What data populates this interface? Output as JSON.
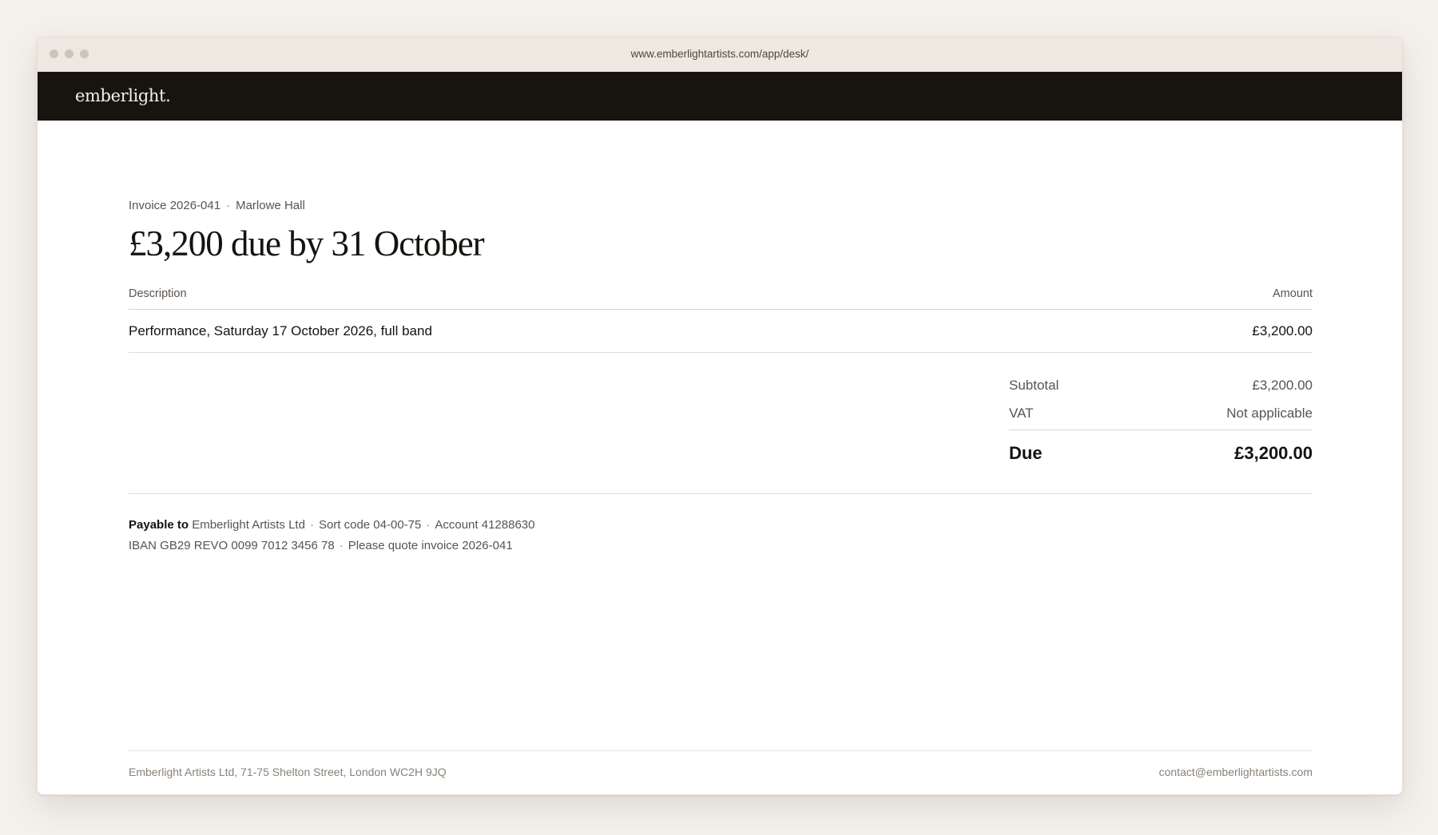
{
  "browser": {
    "url": "www.emberlightartists.com/app/desk/"
  },
  "brand": {
    "logo_text": "emberlight."
  },
  "invoice": {
    "number": "Invoice 2026-041",
    "separator": "·",
    "client": "Marlowe Hall",
    "title": "£3,200 due by 31 October",
    "table": {
      "columns": [
        "Description",
        "Amount"
      ],
      "rows": [
        {
          "description": "Performance, Saturday 17 October 2026, full band",
          "amount": "£3,200.00"
        }
      ]
    },
    "totals": {
      "subtotal_label": "Subtotal",
      "subtotal_value": "£3,200.00",
      "vat_label": "VAT",
      "vat_value": "Not applicable",
      "due_label": "Due",
      "due_value": "£3,200.00"
    },
    "payment": {
      "label": "Payable to",
      "payee": "Emberlight Artists Ltd",
      "sort_code": "Sort code 04-00-75",
      "account": "Account 41288630",
      "iban": "IBAN GB29 REVO 0099 7012 3456 78",
      "reference_note": "Please quote invoice 2026-041"
    }
  },
  "footer": {
    "address": "Emberlight Artists Ltd, 71-75 Shelton Street, London WC2H 9JQ",
    "email": "contact@emberlightartists.com"
  },
  "colors": {
    "page_background": "#f4f1ec",
    "titlebar": "#efe8e1",
    "brand_bar": "#17130f",
    "text_primary": "#15120f",
    "text_secondary": "#5a534c",
    "text_muted": "#8a8178"
  }
}
